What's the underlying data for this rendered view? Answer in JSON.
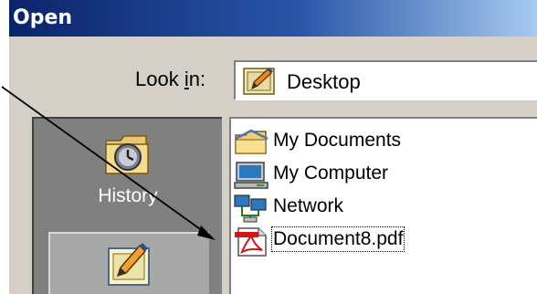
{
  "dialog": {
    "title": "Open",
    "look_in": {
      "label_before": "Look ",
      "label_accel": "i",
      "label_after": "n:",
      "value": "Desktop",
      "icon": "desktop-icon"
    },
    "places": [
      {
        "label": "History",
        "icon": "history-icon"
      },
      {
        "label": "",
        "icon": "desktop-icon"
      }
    ],
    "files": [
      {
        "name": "My Documents",
        "icon": "my-documents-icon"
      },
      {
        "name": "My Computer",
        "icon": "my-computer-icon"
      },
      {
        "name": "Network",
        "icon": "network-icon"
      },
      {
        "name": "Document8.pdf",
        "icon": "pdf-file-icon",
        "selected": true
      }
    ]
  },
  "colors": {
    "titlebar_start": "#0a246a",
    "titlebar_end": "#a6caf0",
    "dialog_face": "#d4d0c8",
    "places_bar": "#808080"
  }
}
